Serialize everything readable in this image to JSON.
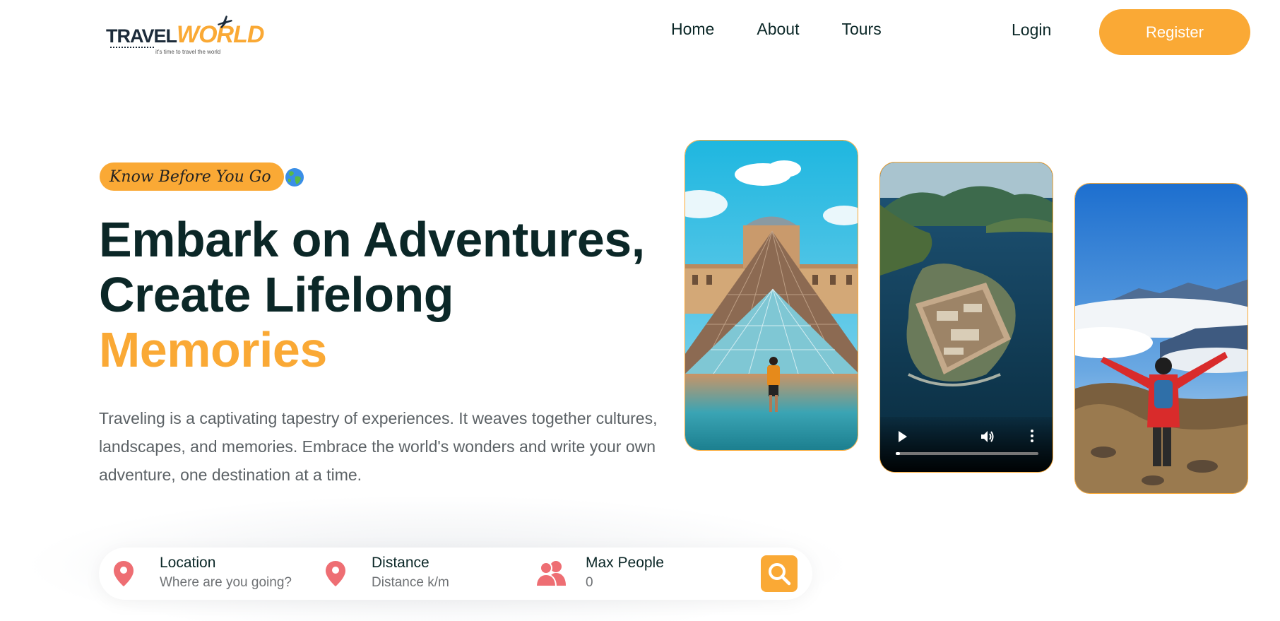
{
  "brand": {
    "name_part1": "TRAVEL",
    "name_part2": "WORLD",
    "tagline": "it's time to travel the world",
    "accent_color": "#faa935",
    "dark_color": "#0b2727"
  },
  "nav": {
    "items": [
      {
        "label": "Home"
      },
      {
        "label": "About"
      },
      {
        "label": "Tours"
      }
    ],
    "login_label": "Login",
    "register_label": "Register"
  },
  "hero": {
    "badge": "Know Before You Go",
    "badge_icon": "globe-icon",
    "headline_line1": "Embark on Adventures,",
    "headline_line2": "Create Lifelong",
    "headline_accent": "Memories",
    "description": "Traveling is a captivating tapestry of experiences. It weaves together cultures, landscapes, and memories. Embrace the world's wonders and write your own adventure, one destination at a time."
  },
  "media": {
    "cards": [
      {
        "kind": "image",
        "subject": "louvre-pyramid-photo"
      },
      {
        "kind": "video",
        "subject": "island-fortress-video",
        "progress": 0.03
      },
      {
        "kind": "image",
        "subject": "mountain-hiker-photo"
      }
    ]
  },
  "search": {
    "fields": [
      {
        "label": "Location",
        "placeholder": "Where are you going?",
        "icon": "map-pin-icon"
      },
      {
        "label": "Distance",
        "placeholder": "Distance k/m",
        "icon": "map-pin-icon"
      },
      {
        "label": "Max People",
        "placeholder": "0",
        "icon": "group-icon"
      }
    ],
    "button_icon": "search-icon"
  }
}
